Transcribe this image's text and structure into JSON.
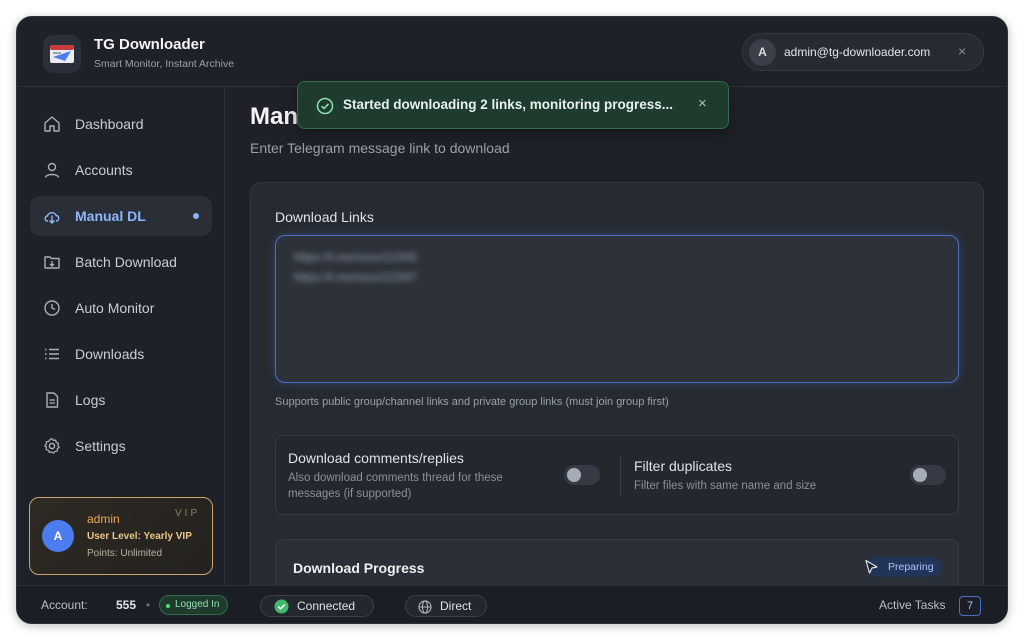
{
  "app": {
    "title": "TG Downloader",
    "subtitle": "Smart Monitor, Instant Archive"
  },
  "user_chip": {
    "avatar": "A",
    "email": "admin@tg-downloader.com",
    "close": "×"
  },
  "sidebar": {
    "items": [
      {
        "label": "Dashboard",
        "icon": "home-icon",
        "active": false
      },
      {
        "label": "Accounts",
        "icon": "user-icon",
        "active": false
      },
      {
        "label": "Manual DL",
        "icon": "cloud-download-icon",
        "active": true
      },
      {
        "label": "Batch Download",
        "icon": "folder-download-icon",
        "active": false
      },
      {
        "label": "Auto Monitor",
        "icon": "clock-icon",
        "active": false
      },
      {
        "label": "Downloads",
        "icon": "list-icon",
        "active": false
      },
      {
        "label": "Logs",
        "icon": "document-icon",
        "active": false
      },
      {
        "label": "Settings",
        "icon": "gear-icon",
        "active": false
      }
    ],
    "vip_card": {
      "avatar": "A",
      "name": "admin",
      "level": "User Level:  Yearly VIP",
      "points": "Points: Unlimited",
      "tag": "VIP"
    }
  },
  "main": {
    "title": "Man",
    "description": "Enter Telegram message link to download",
    "links_label": "Download Links",
    "links": [
      "https://t.me/xxxx/12345",
      "https://t.me/xxxx/12347"
    ],
    "help_text": "Supports public group/channel links and private group links (must join group first)",
    "options": {
      "comments_title": "Download comments/replies",
      "comments_desc": "Also download comments thread for these messages (if supported)",
      "comments_enabled": false,
      "dedupe_title": "Filter duplicates",
      "dedupe_desc": "Filter files with same name and size",
      "dedupe_enabled": false
    },
    "progress": {
      "title": "Download Progress",
      "status": "Preparing"
    }
  },
  "toast": {
    "message": "Started downloading 2 links, monitoring progress...",
    "close": "×"
  },
  "statusbar": {
    "account_label": "Account:",
    "account_value": "555",
    "separator": "•",
    "logged_in": "Logged In",
    "connected": "Connected",
    "direct": "Direct",
    "active_tasks_label": "Active Tasks",
    "active_tasks_count": "7"
  },
  "colors": {
    "accent": "#8fb6ff",
    "success": "#4ade80",
    "vip_gold": "#c9a36a",
    "background": "#1e2127"
  }
}
